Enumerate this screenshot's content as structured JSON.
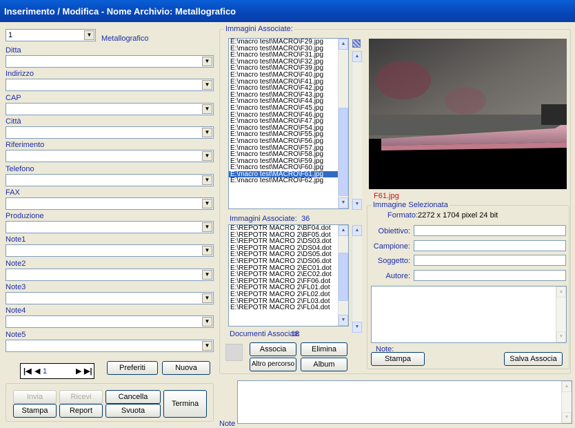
{
  "window": {
    "title": "Inserimento / Modifica - Nome Archivio: Metallografico"
  },
  "left": {
    "archive_select": {
      "value": "1"
    },
    "archive_name": "Metallografico",
    "fields": [
      {
        "label": "Ditta",
        "value": ""
      },
      {
        "label": "Indirizzo",
        "value": ""
      },
      {
        "label": "CAP",
        "value": ""
      },
      {
        "label": "Città",
        "value": ""
      },
      {
        "label": "Riferimento",
        "value": ""
      },
      {
        "label": "Telefono",
        "value": ""
      },
      {
        "label": "FAX",
        "value": ""
      },
      {
        "label": "Produzione",
        "value": ""
      },
      {
        "label": "Note1",
        "value": ""
      },
      {
        "label": "Note2",
        "value": ""
      },
      {
        "label": "Note3",
        "value": ""
      },
      {
        "label": "Note4",
        "value": ""
      },
      {
        "label": "Note5",
        "value": ""
      }
    ],
    "navigator": {
      "record": "1",
      "first": "⏮",
      "prev": "◀",
      "next": "▶",
      "last": "⏭"
    },
    "buttons": {
      "preferiti": "Preferiti",
      "nuova": "Nuova",
      "invia": "Invia",
      "ricevi": "Ricevi",
      "cancella": "Cancella",
      "termina": "Termina",
      "stampa": "Stampa",
      "report": "Report",
      "svuota": "Svuota"
    }
  },
  "images": {
    "group_label": "Immagini Associate:",
    "list": [
      "E:\\macro test\\MACRO\\F29.jpg",
      "E:\\macro test\\MACRO\\F30.jpg",
      "E:\\macro test\\MACRO\\F31.jpg",
      "E:\\macro test\\MACRO\\F32.jpg",
      "E:\\macro test\\MACRO\\F39.jpg",
      "E:\\macro test\\MACRO\\F40.jpg",
      "E:\\macro test\\MACRO\\F41.jpg",
      "E:\\macro test\\MACRO\\F42.jpg",
      "E:\\macro test\\MACRO\\F43.jpg",
      "E:\\macro test\\MACRO\\F44.jpg",
      "E:\\macro test\\MACRO\\F45.jpg",
      "E:\\macro test\\MACRO\\F46.jpg",
      "E:\\macro test\\MACRO\\F47.jpg",
      "E:\\macro test\\MACRO\\F54.jpg",
      "E:\\macro test\\MACRO\\F55.jpg",
      "E:\\macro test\\MACRO\\F56.jpg",
      "E:\\macro test\\MACRO\\F57.jpg",
      "E:\\macro test\\MACRO\\F58.jpg",
      "E:\\macro test\\MACRO\\F59.jpg",
      "E:\\macro test\\MACRO\\F60.jpg",
      "E:\\macro test\\MACRO\\F61.jpg",
      "E:\\macro test\\MACRO\\F62.jpg"
    ],
    "selected_index": 20,
    "count_label": "Immagini Associate:",
    "count": "36",
    "preview_filename": "F61.jpg"
  },
  "documents": {
    "list": [
      "E:\\REPOTR MACRO 2\\BF04.dot",
      "E:\\REPOTR MACRO 2\\BF05.dot",
      "E:\\REPOTR MACRO 2\\DS03.dot",
      "E:\\REPOTR MACRO 2\\DS04.dot",
      "E:\\REPOTR MACRO 2\\DS05.dot",
      "E:\\REPOTR MACRO 2\\DS06.dot",
      "E:\\REPOTR MACRO 2\\EC01.dot",
      "E:\\REPOTR MACRO 2\\EC02.dot",
      "E:\\REPOTR MACRO 2\\FF06.dot",
      "E:\\REPOTR MACRO 2\\FL01.dot",
      "E:\\REPOTR MACRO 2\\FL02.dot",
      "E:\\REPOTR MACRO 2\\FL03.dot",
      "E:\\REPOTR MACRO 2\\FL04.dot"
    ],
    "count_label": "Documenti Associati:",
    "count": "18",
    "buttons": {
      "associa": "Associa",
      "elimina": "Elimina",
      "altro_percorso": "Altro percorso",
      "album": "Album"
    }
  },
  "selected_image": {
    "group_label": "Immagine Selezionata",
    "formato_label": "Formato:",
    "formato_value": "2272 x 1704 pixel  24 bit",
    "fields": [
      {
        "label": "Obiettivo:",
        "value": ""
      },
      {
        "label": "Campione:",
        "value": ""
      },
      {
        "label": "Soggetto:",
        "value": ""
      },
      {
        "label": "Autore:",
        "value": ""
      }
    ],
    "note_label": "Note:",
    "buttons": {
      "stampa": "Stampa",
      "salva_associa": "Salva Associa"
    }
  },
  "bottom": {
    "note_label": "Note",
    "note_value": ""
  }
}
